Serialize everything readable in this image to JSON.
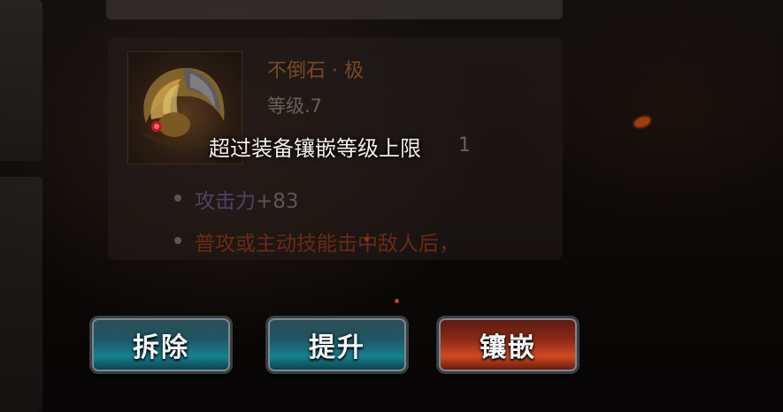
{
  "item": {
    "name": "不倒石 · 极",
    "level": "等级.7",
    "hidden_number": "1",
    "icon": "winged-helmet-gem-icon"
  },
  "attributes": [
    {
      "name": "攻击力",
      "value": "+83"
    },
    {
      "text": "普攻或主动技能击中敌人后，"
    }
  ],
  "toast": {
    "message": "超过装备镶嵌等级上限"
  },
  "buttons": {
    "remove": "拆除",
    "upgrade": "提升",
    "inlay": "镶嵌"
  },
  "colors": {
    "button_blue": "#15818f",
    "button_red": "#d04a22",
    "item_name": "#7a4a22",
    "attribute_name": "#4a4568",
    "effect_text": "#6b2a14"
  }
}
